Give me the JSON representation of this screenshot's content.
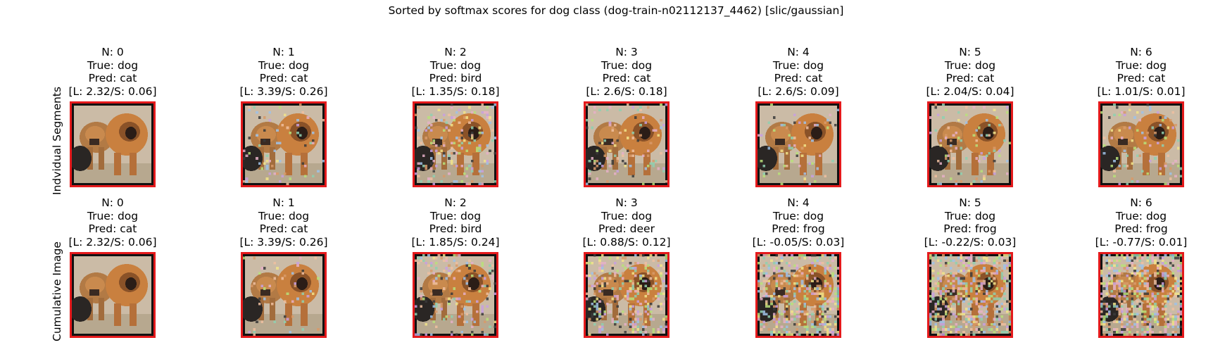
{
  "title": "Sorted by softmax scores for dog class (dog-train-n02112137_4462) [slic/gaussian]",
  "colors": {
    "frame": "#e41a1c"
  },
  "rows": [
    {
      "label": "Indvidual Segments",
      "panels": [
        {
          "n": "N: 0",
          "true": "True: dog",
          "pred": "Pred: cat",
          "score": "[L: 2.32/S: 0.06]",
          "noise_level": 0.0
        },
        {
          "n": "N: 1",
          "true": "True: dog",
          "pred": "Pred: cat",
          "score": "[L: 3.39/S: 0.26]",
          "noise_level": 0.1
        },
        {
          "n": "N: 2",
          "true": "True: dog",
          "pred": "Pred: bird",
          "score": "[L: 1.35/S: 0.18]",
          "noise_level": 0.25
        },
        {
          "n": "N: 3",
          "true": "True: dog",
          "pred": "Pred: cat",
          "score": "[L: 2.6/S: 0.18]",
          "noise_level": 0.2
        },
        {
          "n": "N: 4",
          "true": "True: dog",
          "pred": "Pred: cat",
          "score": "[L: 2.6/S: 0.09]",
          "noise_level": 0.12
        },
        {
          "n": "N: 5",
          "true": "True: dog",
          "pred": "Pred: cat",
          "score": "[L: 2.04/S: 0.04]",
          "noise_level": 0.15
        },
        {
          "n": "N: 6",
          "true": "True: dog",
          "pred": "Pred: cat",
          "score": "[L: 1.01/S: 0.01]",
          "noise_level": 0.15
        }
      ]
    },
    {
      "label": "Cumulative Image",
      "panels": [
        {
          "n": "N: 0",
          "true": "True: dog",
          "pred": "Pred: cat",
          "score": "[L: 2.32/S: 0.06]",
          "noise_level": 0.0
        },
        {
          "n": "N: 1",
          "true": "True: dog",
          "pred": "Pred: cat",
          "score": "[L: 3.39/S: 0.26]",
          "noise_level": 0.1
        },
        {
          "n": "N: 2",
          "true": "True: dog",
          "pred": "Pred: bird",
          "score": "[L: 1.85/S: 0.24]",
          "noise_level": 0.3
        },
        {
          "n": "N: 3",
          "true": "True: dog",
          "pred": "Pred: deer",
          "score": "[L: 0.88/S: 0.12]",
          "noise_level": 0.45
        },
        {
          "n": "N: 4",
          "true": "True: dog",
          "pred": "Pred: frog",
          "score": "[L: -0.05/S: 0.03]",
          "noise_level": 0.6
        },
        {
          "n": "N: 5",
          "true": "True: dog",
          "pred": "Pred: frog",
          "score": "[L: -0.22/S: 0.03]",
          "noise_level": 0.7
        },
        {
          "n": "N: 6",
          "true": "True: dog",
          "pred": "Pred: frog",
          "score": "[L: -0.77/S: 0.01]",
          "noise_level": 0.8
        }
      ]
    }
  ]
}
